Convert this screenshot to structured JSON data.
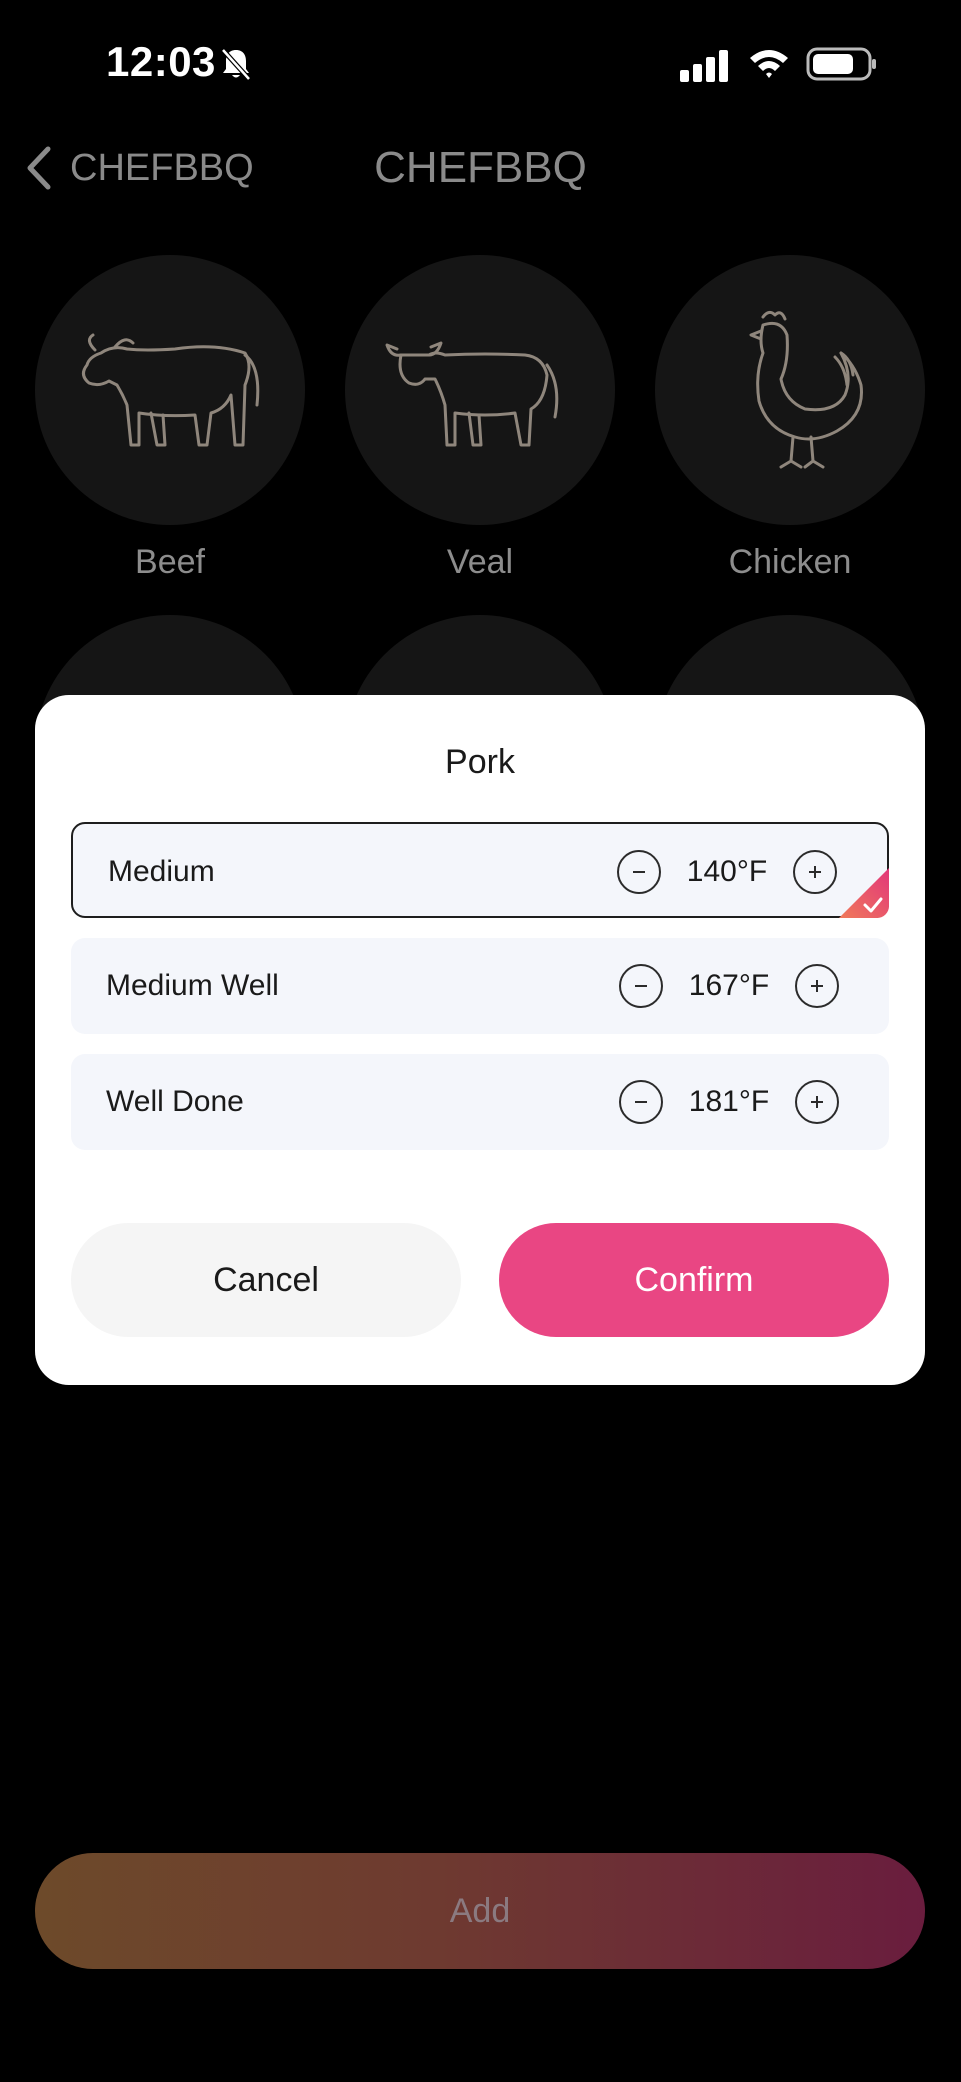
{
  "status_bar": {
    "time": "12:03",
    "icons": [
      "bell-slash-icon",
      "cellular-signal-icon",
      "wifi-icon",
      "battery-icon"
    ]
  },
  "nav": {
    "back_label": "CHEFBBQ",
    "title": "CHEFBBQ"
  },
  "categories": [
    {
      "label": "Beef",
      "icon": "cow-icon"
    },
    {
      "label": "Veal",
      "icon": "calf-icon"
    },
    {
      "label": "Chicken",
      "icon": "chicken-icon"
    }
  ],
  "add_button": {
    "label": "Add"
  },
  "dialog": {
    "title": "Pork",
    "options": [
      {
        "label": "Medium",
        "value": "140°F",
        "selected": true
      },
      {
        "label": "Medium Well",
        "value": "167°F",
        "selected": false
      },
      {
        "label": "Well Done",
        "value": "181°F",
        "selected": false
      }
    ],
    "cancel_label": "Cancel",
    "confirm_label": "Confirm"
  },
  "colors": {
    "accent": "#e94683",
    "background": "#000000",
    "option_bg": "#f4f6fb"
  }
}
